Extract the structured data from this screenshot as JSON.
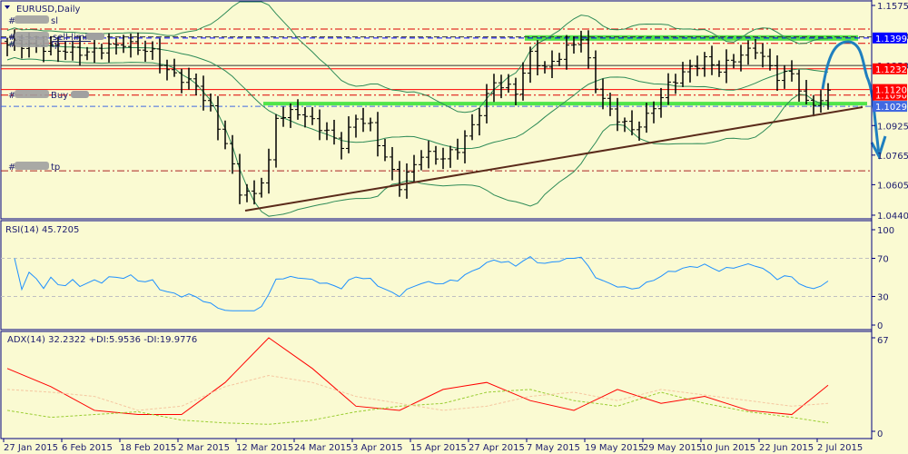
{
  "symbol_title": "EURUSD,Daily",
  "price_pane": {
    "price_range": [
      1.044,
      1.1575
    ],
    "tick_labels": [
      "1.1575",
      "1.0925",
      "1.0765",
      "1.0605",
      "1.0440"
    ],
    "hidden_ticks": [
      "1.1410",
      "1.1250"
    ],
    "price_tags": [
      {
        "text": "1.1399",
        "price": 1.1399,
        "color": "#0000ff"
      },
      {
        "text": "1.1232",
        "price": 1.1232,
        "color": "#ff0000"
      },
      {
        "text": "1.1090",
        "price": 1.109,
        "color": "#ff0000"
      },
      {
        "text": "1.1120",
        "price": 1.112,
        "color": "#ff0000"
      },
      {
        "text": "1.1029",
        "price": 1.1029,
        "color": "#4169e1"
      }
    ],
    "order_labels": [
      {
        "prefix": "#",
        "text": "sl",
        "price": 1.1447
      },
      {
        "prefix": "#",
        "text": "sell limit",
        "price": 1.1399
      },
      {
        "prefix": "#",
        "text": "tp",
        "price": 1.137
      },
      {
        "prefix": "#",
        "text": "Buy",
        "price": 1.112
      },
      {
        "prefix": "#",
        "text": "tp",
        "price": 1.068
      }
    ]
  },
  "chart_data": [
    {
      "type": "ohlc",
      "title": "EURUSD,Daily",
      "bars": 114,
      "close_keypoints": [
        [
          0,
          1.136
        ],
        [
          1,
          1.137
        ],
        [
          6,
          1.134
        ],
        [
          11,
          1.132
        ],
        [
          16,
          1.137
        ],
        [
          20,
          1.132
        ],
        [
          22,
          1.122
        ],
        [
          26,
          1.114
        ],
        [
          28,
          1.101
        ],
        [
          30,
          1.083
        ],
        [
          32,
          1.057
        ],
        [
          34,
          1.055
        ],
        [
          36,
          1.072
        ],
        [
          37,
          1.097
        ],
        [
          40,
          1.1
        ],
        [
          43,
          1.092
        ],
        [
          46,
          1.082
        ],
        [
          48,
          1.097
        ],
        [
          50,
          1.092
        ],
        [
          52,
          1.075
        ],
        [
          54,
          1.06
        ],
        [
          57,
          1.077
        ],
        [
          60,
          1.075
        ],
        [
          62,
          1.08
        ],
        [
          64,
          1.092
        ],
        [
          67,
          1.116
        ],
        [
          70,
          1.111
        ],
        [
          72,
          1.131
        ],
        [
          74,
          1.123
        ],
        [
          77,
          1.134
        ],
        [
          79,
          1.14
        ],
        [
          81,
          1.114
        ],
        [
          83,
          1.1
        ],
        [
          86,
          1.09
        ],
        [
          88,
          1.097
        ],
        [
          91,
          1.114
        ],
        [
          93,
          1.121
        ],
        [
          96,
          1.128
        ],
        [
          98,
          1.123
        ],
        [
          101,
          1.131
        ],
        [
          103,
          1.134
        ],
        [
          106,
          1.119
        ],
        [
          108,
          1.121
        ],
        [
          110,
          1.104
        ],
        [
          112,
          1.106
        ],
        [
          113,
          1.11
        ]
      ],
      "indicators": [
        "Bollinger Bands(20,2)"
      ],
      "x_tick_labels": [
        "27 Jan 2015",
        "6 Feb 2015",
        "18 Feb 2015",
        "2 Mar 2015",
        "12 Mar 2015",
        "24 Mar 2015",
        "3 Apr 2015",
        "15 Apr 2015",
        "27 Apr 2015",
        "7 May 2015",
        "19 May 2015",
        "29 May 2015",
        "10 Jun 2015",
        "22 Jun 2015",
        "2 Jul 2015"
      ]
    },
    {
      "type": "line",
      "title": "RSI(14) 45.7205",
      "ylim": [
        0,
        100
      ],
      "levels": [
        30,
        70
      ],
      "tick_labels": [
        "100",
        "70",
        "30",
        "0"
      ]
    },
    {
      "type": "line",
      "title": "ADX(14) 32.2322 +DI:5.9536 -DI:19.9776",
      "ylim": [
        0,
        67
      ],
      "tick_labels": [
        "67",
        "0"
      ],
      "sample_step_bars": 6,
      "series": [
        {
          "name": "ADX",
          "color": "#ff0000",
          "values": [
            45,
            32,
            15,
            12,
            12,
            35,
            67,
            45,
            18,
            15,
            30,
            35,
            22,
            15,
            30,
            20,
            25,
            15,
            12,
            33
          ]
        },
        {
          "name": "+DI",
          "color": "#9acd32",
          "values": [
            15,
            10,
            12,
            14,
            8,
            6,
            5,
            8,
            14,
            18,
            20,
            28,
            30,
            22,
            18,
            28,
            20,
            14,
            10,
            6
          ]
        },
        {
          "name": "-DI",
          "color": "#f5c6a0",
          "values": [
            30,
            28,
            25,
            15,
            18,
            32,
            40,
            35,
            25,
            20,
            15,
            18,
            25,
            28,
            22,
            30,
            26,
            22,
            18,
            20
          ]
        }
      ]
    }
  ],
  "colors": {
    "background": "#fafad2",
    "axis": "#000080",
    "bollinger": "#2e8b57",
    "rsi": "#1e90ff",
    "trendline": "#5a2a1a",
    "forecast_arrow": "#1f7fbf"
  }
}
